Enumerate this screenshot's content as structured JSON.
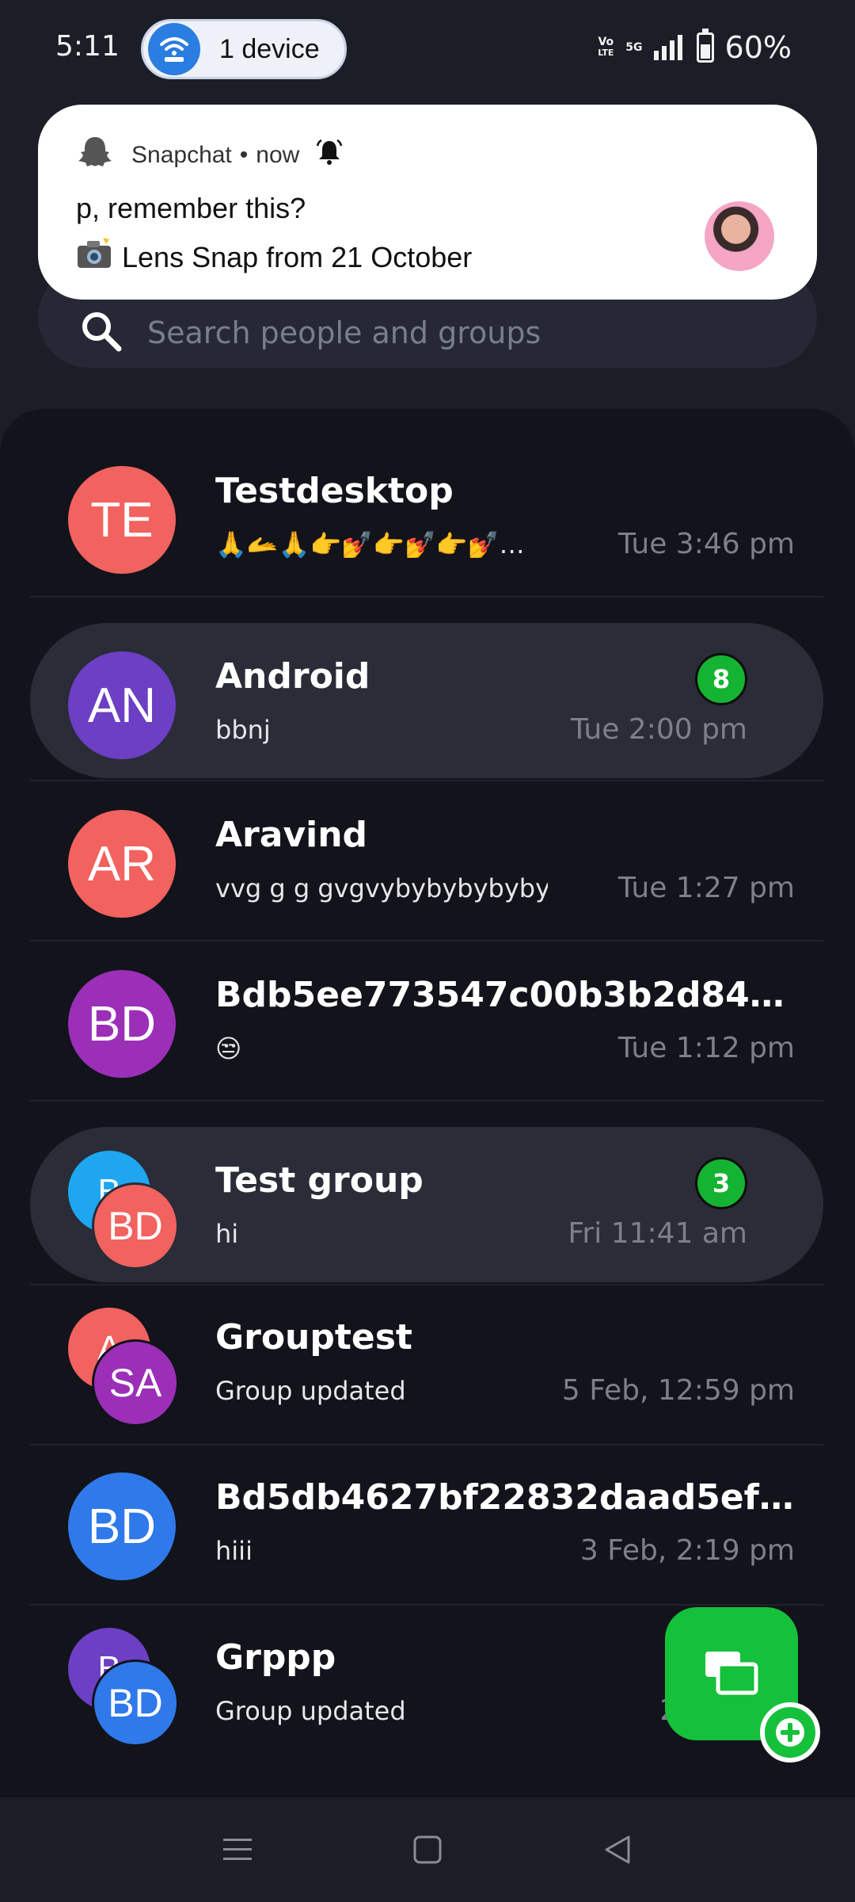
{
  "status_bar": {
    "time": "5:11",
    "hotspot_label": "1 device",
    "volte_top": "Vo",
    "volte_bottom": "LTE",
    "network": "5G",
    "battery": "60%"
  },
  "notification": {
    "app_name": "Snapchat",
    "separator": "•",
    "when": "now",
    "title": "p, remember this?",
    "body_icon": "camera-flash-emoji",
    "body": "Lens Snap from 21 October"
  },
  "search": {
    "placeholder": "Search people and groups"
  },
  "chats": [
    {
      "name": "Testdesktop",
      "preview": "🙏🫴🙏👉💅👉💅👉💅…",
      "time": "Tue 3:46 pm",
      "initials": "TE",
      "color": "#f2625f",
      "highlight": false
    },
    {
      "name": "Android",
      "preview": "bbnj",
      "time": "Tue 2:00 pm",
      "initials": "AN",
      "color": "#6c3fc4",
      "highlight": true,
      "unread": "8"
    },
    {
      "name": "Aravind",
      "preview": "vvg g g gvgvybybybybyby…",
      "time": "Tue 1:27 pm",
      "initials": "AR",
      "color": "#f2625f",
      "highlight": false
    },
    {
      "name": "Bdb5ee773547c00b3b2d84…",
      "preview": "😒",
      "time": "Tue 1:12 pm",
      "initials": "BD",
      "color": "#9b2fb8",
      "highlight": false
    },
    {
      "name": "Test group",
      "preview": "hi",
      "time": "Fri 11:41 am",
      "back_initials": "B",
      "back_color": "#1ea7f0",
      "initials": "BD",
      "color": "#f2625f",
      "highlight": true,
      "unread": "3"
    },
    {
      "name": "Grouptest",
      "preview": "Group updated",
      "time": "5 Feb, 12:59 pm",
      "back_initials": "A",
      "back_color": "#f2625f",
      "initials": "SA",
      "color": "#9b2fb8",
      "highlight": false
    },
    {
      "name": "Bd5db4627bf22832daad5ef…",
      "preview": "hiii",
      "time": "3 Feb, 2:19 pm",
      "initials": "BD",
      "color": "#2f79ea",
      "highlight": false
    },
    {
      "name": "Grppp",
      "preview": "Group updated",
      "time": "29 Jan, 5:",
      "back_initials": "B",
      "back_color": "#6c3fc4",
      "initials": "BD",
      "color": "#2f79ea",
      "highlight": false
    }
  ],
  "fab": {
    "icon": "new-chat-icon",
    "color": "#15c03a"
  },
  "nav": {
    "menu_icon": "menu-icon",
    "home_icon": "home-square-icon",
    "back_icon": "back-triangle-icon"
  }
}
